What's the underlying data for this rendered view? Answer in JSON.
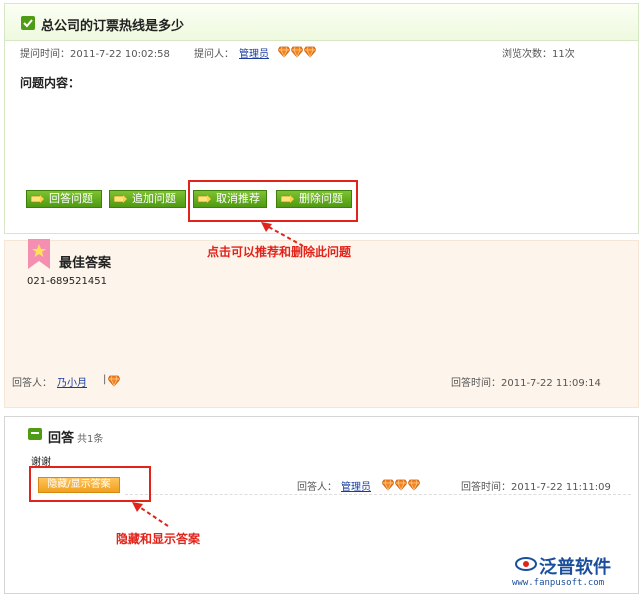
{
  "question": {
    "title": "总公司的订票热线是多少",
    "ask_time_label": "提问时间：2011-7-22 10:02:58",
    "asker_label": "提问人：",
    "asker_name": "管理员",
    "view_count_label": "浏览次数：11次",
    "content_label": "问题内容：",
    "buttons": {
      "answer": "回答问题",
      "follow_up": "追加问题",
      "cancel_recommend": "取消推荐",
      "delete": "删除问题"
    }
  },
  "annotations": {
    "recommend_delete": "点击可以推荐和删除此问题",
    "hide_show": "隐藏和显示答案"
  },
  "best_answer": {
    "title": "最佳答案",
    "text": "021-689521451",
    "answerer_label": "回答人：",
    "answerer_name": "乃小月",
    "separator": "|",
    "answer_time_label": "回答时间：2011-7-22 11:09:14"
  },
  "answers": {
    "title": "回答",
    "count": "共1条",
    "items": [
      {
        "text": "谢谢",
        "toggle_label": "隐藏/显示答案",
        "answerer_label": "回答人：",
        "answerer_name": "管理员",
        "answer_time_label": "回答时间：2011-7-22 11:11:09"
      }
    ]
  },
  "logo": {
    "name": "泛普软件",
    "url": "www.fanpusoft.com"
  },
  "colors": {
    "accent_green": "#4e9a12",
    "annotation_red": "#e2231a",
    "best_answer_bg": "#fdf5ec",
    "gem_orange": "#f58220",
    "toggle_orange": "#f0a020"
  },
  "icons": [
    "check-icon",
    "gem-icon",
    "ribbon-icon",
    "speech-bubble-icon",
    "pencil-icon"
  ]
}
